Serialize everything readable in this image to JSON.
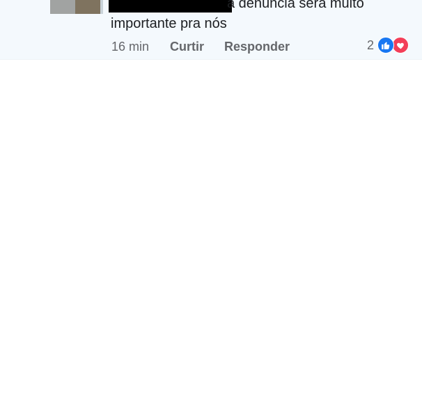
{
  "comment": {
    "text_line1": "a denúncia será muito",
    "text_line2": "importante pra nós",
    "time": "16 min",
    "like_label": "Curtir",
    "reply_label": "Responder",
    "reaction_count": "2",
    "reactions": [
      "like-icon",
      "love-icon"
    ]
  },
  "colors": {
    "card_background": "#f4f9fd",
    "meta_text": "#65676b",
    "like_blue": "#1877f2",
    "love_red": "#f33e58"
  }
}
